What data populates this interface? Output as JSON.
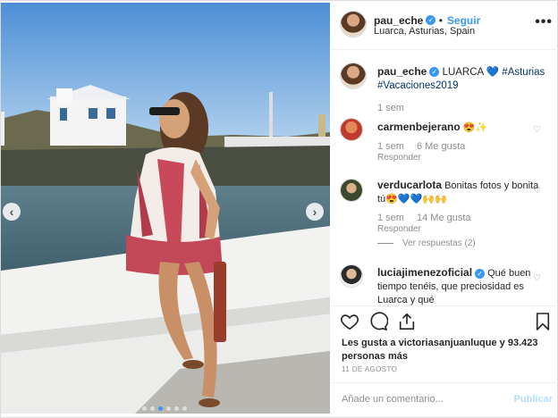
{
  "header": {
    "username": "pau_eche",
    "follow_label": "Seguir",
    "location": "Luarca, Asturias, Spain",
    "more_label": "•••"
  },
  "caption": {
    "username": "pau_eche",
    "text": "LUARCA 💙",
    "hashtag1": "#Asturias",
    "hashtag2": "#Vacaciones2019",
    "time": "1 sem"
  },
  "comments": [
    {
      "username": "carmenbejerano",
      "text": "😍✨",
      "time": "1 sem",
      "likes": "6 Me gusta",
      "reply": "Responder"
    },
    {
      "username": "verducarlota",
      "text": "Bonitas fotos y bonita tú😍💙💙🙌🙌",
      "time": "1 sem",
      "likes": "14 Me gusta",
      "reply": "Responder",
      "view_replies": "Ver respuestas (2)"
    },
    {
      "username": "luciajimenezoficial",
      "text": "Qué buen tiempo tenéis, que preciosidad es Luarca y qué",
      "verified": true
    }
  ],
  "actions": {
    "likes_text": "Les gusta a victoriasanjuanluque y 93.423 personas más",
    "date": "11 DE AGOSTO"
  },
  "add_comment": {
    "placeholder": "Añade un comentario...",
    "publish_label": "Publicar"
  },
  "carousel": {
    "prev": "‹",
    "next": "›",
    "slides": 6,
    "active_slide": 3
  },
  "colors": {
    "accent": "#3897f0",
    "publish_disabled": "#b2dffc",
    "meta_gray": "#8e8e8e"
  }
}
